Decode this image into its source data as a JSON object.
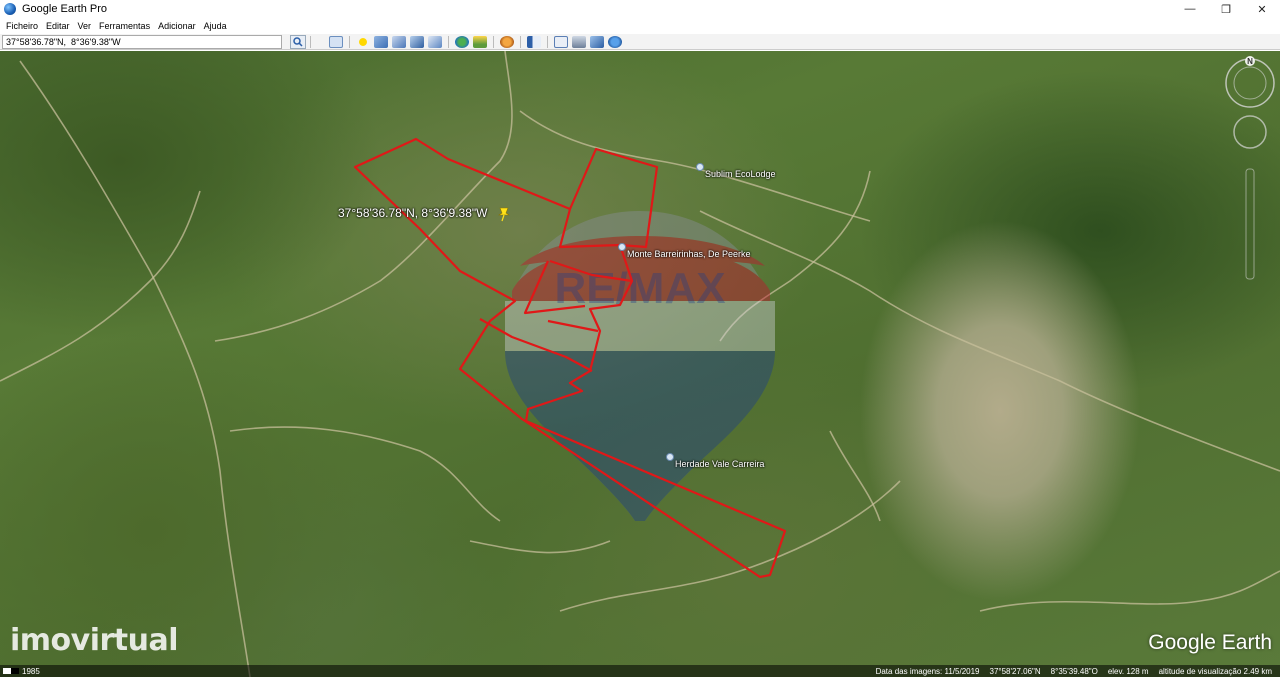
{
  "window": {
    "title": "Google Earth Pro",
    "minimize": "—",
    "maximize": "❐",
    "close": "✕"
  },
  "menu": [
    "Ficheiro",
    "Editar",
    "Ver",
    "Ferramentas",
    "Adicionar",
    "Ajuda"
  ],
  "search": {
    "value": "37°58'36.78\"N,  8°36'9.38\"W"
  },
  "toolbar_icons": [
    "sidebar-toggle-icon",
    "placemark-icon",
    "polygon-icon",
    "path-icon",
    "image-overlay-icon",
    "tour-icon",
    "historical-imagery-icon",
    "sun-icon",
    "planets-icon",
    "ruler-icon",
    "email-icon",
    "print-icon",
    "save-image-icon",
    "maps-icon"
  ],
  "map": {
    "coordinate_label": "37°58'36.78\"N,  8°36'9.38\"W",
    "places": [
      {
        "name": "Sublim EcoLodge"
      },
      {
        "name": "Monte Barreirinhas, De Peerke"
      },
      {
        "name": "Herdade Vale Carreira"
      }
    ],
    "overlay_text": "RE/MAX",
    "north_label": "N",
    "watermark": "imovirtual",
    "brand": "Google Earth"
  },
  "status": {
    "scale": "1985",
    "imagery_date": "Data das imagens: 11/5/2019",
    "lat": "37°58'27.06\"N",
    "lon": "8°35'39.48\"O",
    "elev": "elev. 128 m",
    "eye_alt": "altitude de visualização 2.49 km"
  },
  "colors": {
    "property_boundary": "#e01818",
    "remax_red": "#c8102e",
    "remax_blue": "#1d3e8a"
  }
}
